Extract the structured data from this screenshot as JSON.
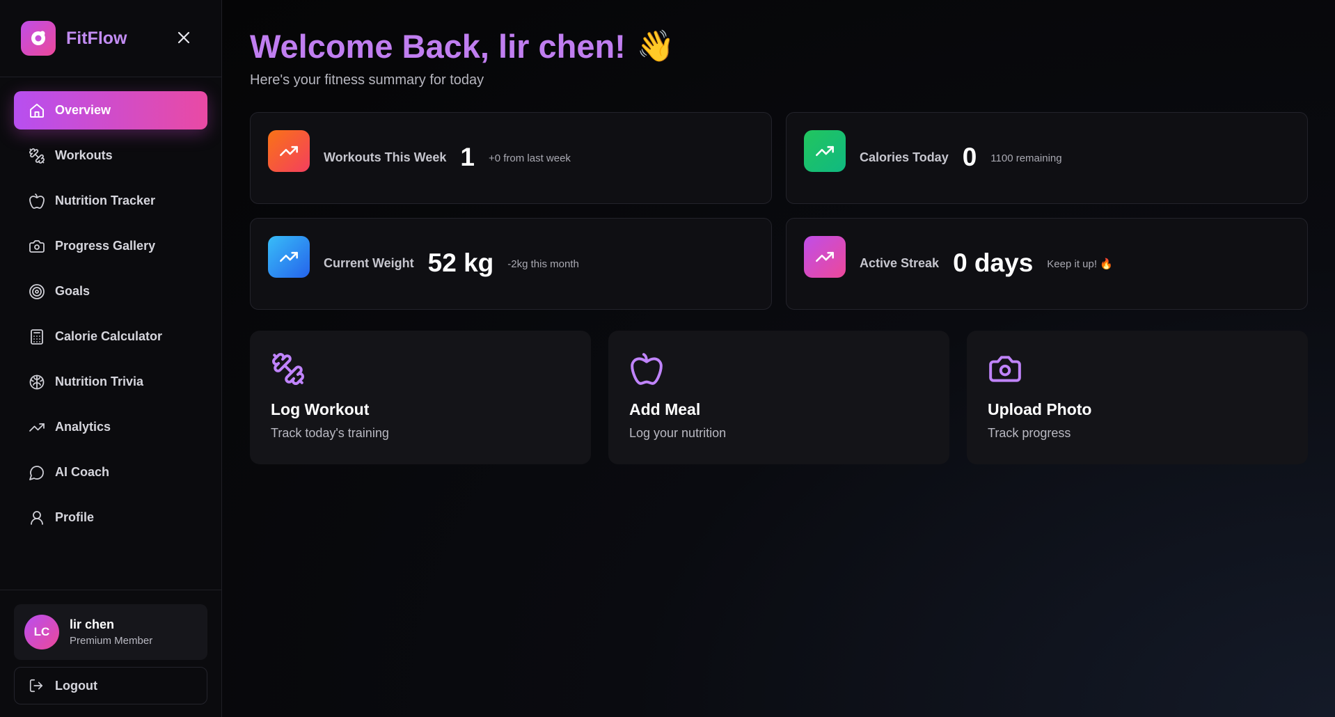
{
  "sidebar": {
    "brand": "FitFlow",
    "nav": [
      {
        "label": "Overview",
        "icon": "home-icon",
        "active": true
      },
      {
        "label": "Workouts",
        "icon": "dumbbell-icon"
      },
      {
        "label": "Nutrition Tracker",
        "icon": "apple-icon"
      },
      {
        "label": "Progress Gallery",
        "icon": "camera-icon"
      },
      {
        "label": "Goals",
        "icon": "target-icon"
      },
      {
        "label": "Calorie Calculator",
        "icon": "calculator-icon"
      },
      {
        "label": "Nutrition Trivia",
        "icon": "brain-icon"
      },
      {
        "label": "Analytics",
        "icon": "trending-up-icon"
      },
      {
        "label": "AI Coach",
        "icon": "chat-bubble-icon"
      },
      {
        "label": "Profile",
        "icon": "user-icon"
      }
    ],
    "user": {
      "initials": "LC",
      "name": "lir chen",
      "role": "Premium Member"
    },
    "logout_label": "Logout"
  },
  "main": {
    "welcome": "Welcome Back, lir chen!",
    "wave": "👋",
    "subtitle": "Here's your fitness summary for today",
    "stats": [
      {
        "label": "Workouts This Week",
        "value": "1",
        "note": "+0 from last week",
        "color_from": "#f97316",
        "color_to": "#f43f5e"
      },
      {
        "label": "Calories Today",
        "value": "0",
        "note": "1100 remaining",
        "color_from": "#22c55e",
        "color_to": "#10b981"
      },
      {
        "label": "Current Weight",
        "value": "52 kg",
        "note": "-2kg this month",
        "color_from": "#38bdf8",
        "color_to": "#2563eb"
      },
      {
        "label": "Active Streak",
        "value": "0 days",
        "note": "Keep it up! 🔥",
        "color_from": "#c04ee8",
        "color_to": "#ec4899"
      }
    ],
    "actions": [
      {
        "title": "Log Workout",
        "desc": "Track today's training",
        "icon": "dumbbell-icon"
      },
      {
        "title": "Add Meal",
        "desc": "Log your nutrition",
        "icon": "apple-icon"
      },
      {
        "title": "Upload Photo",
        "desc": "Track progress",
        "icon": "camera-icon"
      }
    ]
  },
  "colors": {
    "accent": "#c07ef0",
    "accent_gradient_from": "#b74ff0",
    "accent_gradient_to": "#e94aa4",
    "icon_purple": "#c084fc"
  }
}
